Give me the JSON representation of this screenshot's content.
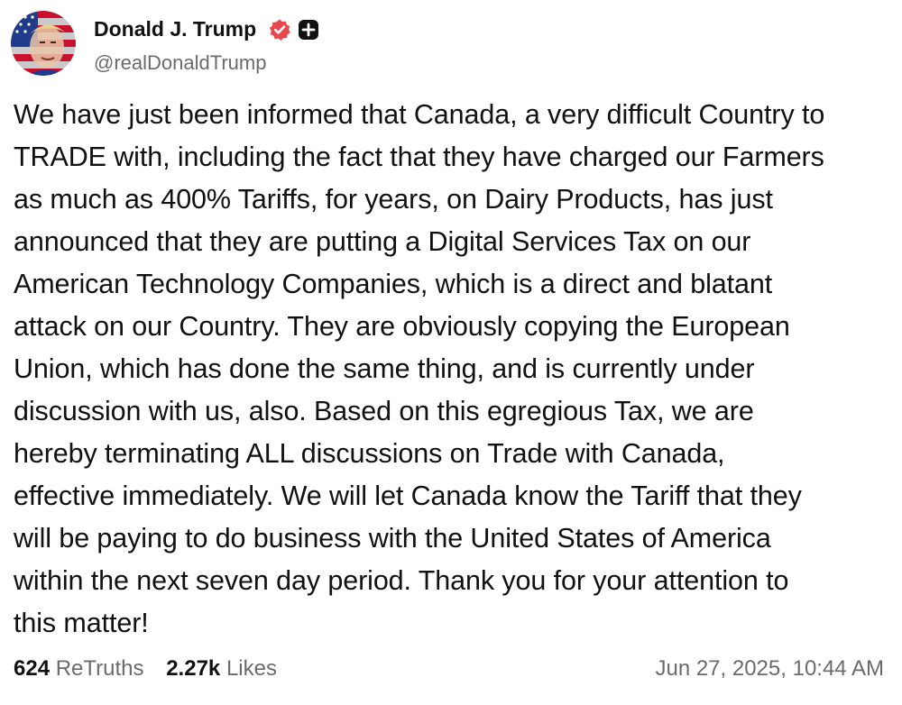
{
  "author": {
    "display_name": "Donald J. Trump",
    "handle": "@realDonaldTrump",
    "avatar_icon": "avatar-portrait-flag",
    "verified_icon": "verified-badge-icon",
    "verified_color": "#e5484d",
    "plus_icon": "plus-badge-icon"
  },
  "post": {
    "lines": [
      "We have just been informed that Canada, a very difficult Country to",
      "TRADE with, including the fact that they have charged our Farmers",
      "as much as 400% Tariffs, for years, on Dairy Products, has just",
      "announced that they are putting a Digital Services Tax on our",
      "American Technology Companies, which is a direct and blatant",
      "attack on our Country. They are obviously copying the European",
      "Union, which has done the same thing, and is currently under",
      "discussion with us, also. Based on this egregious Tax, we are",
      "hereby terminating ALL discussions on Trade with Canada,",
      "effective immediately. We will let Canada know the Tariff that they",
      "will be paying to do business with the United States of America",
      "within the next seven day period. Thank you for your attention to",
      "this matter!"
    ]
  },
  "stats": {
    "retruths_count": "624",
    "retruths_label": "ReTruths",
    "likes_count": "2.27k",
    "likes_label": "Likes"
  },
  "timestamp": "Jun 27, 2025, 10:44 AM",
  "colors": {
    "text": "#111111",
    "muted": "#6b6b6b",
    "background": "#ffffff"
  }
}
